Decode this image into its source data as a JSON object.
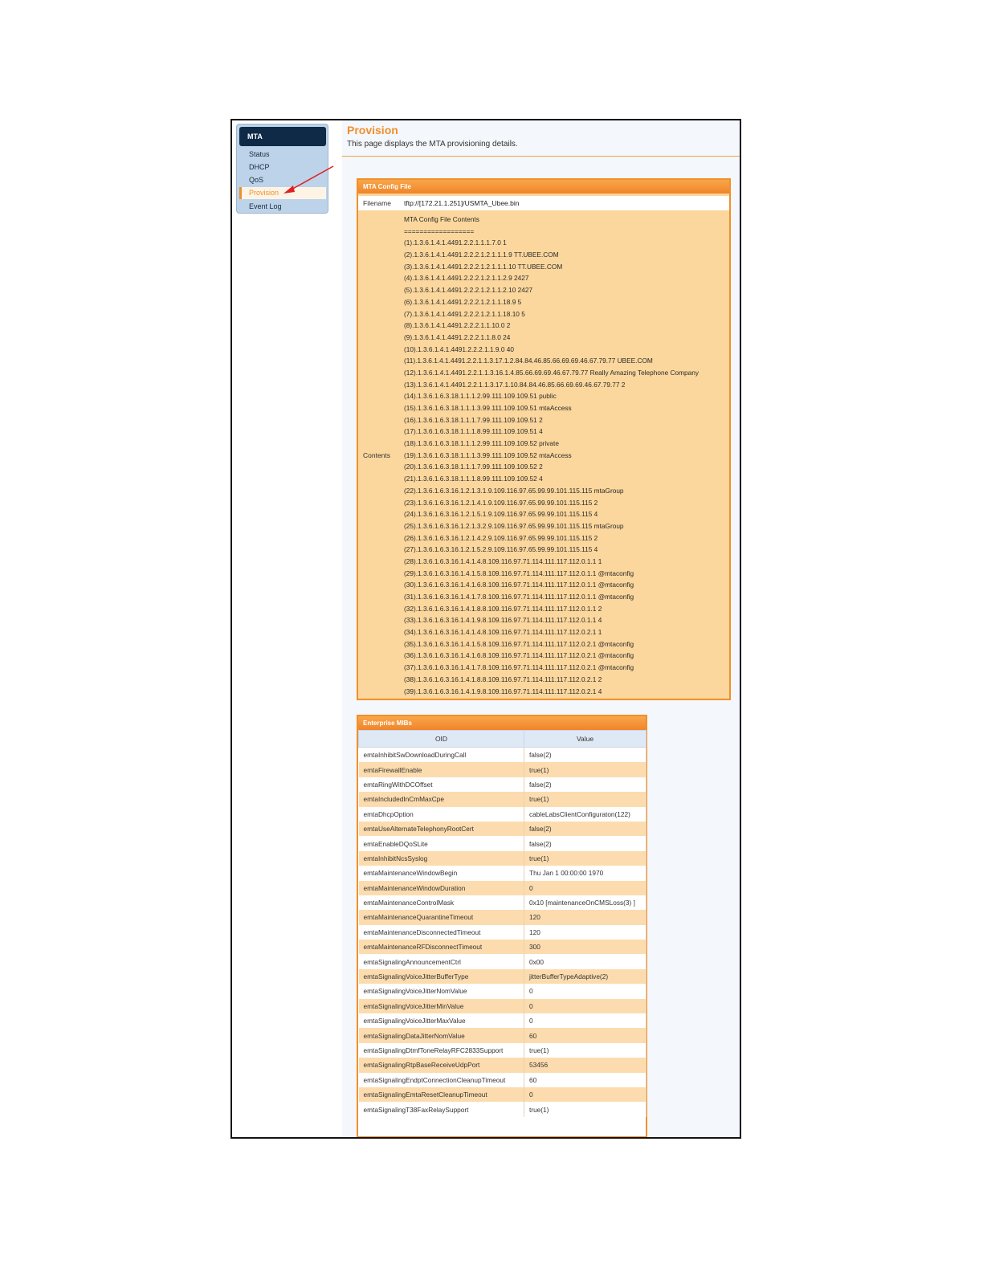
{
  "sidebar": {
    "header": "MTA",
    "items": [
      {
        "label": "Status",
        "active": false
      },
      {
        "label": "DHCP",
        "active": false
      },
      {
        "label": "QoS",
        "active": false
      },
      {
        "label": "Provision",
        "active": true
      },
      {
        "label": "Event Log",
        "active": false
      }
    ]
  },
  "page": {
    "title": "Provision",
    "description": "This page displays the MTA provisioning details."
  },
  "config_file": {
    "header": "MTA Config File",
    "filename_label": "Filename",
    "filename": "tftp://[172.21.1.251]/USMTA_Ubee.bin",
    "contents_label": "Contents",
    "lines": [
      "MTA Config File Contents",
      "==================",
      "(1).1.3.6.1.4.1.4491.2.2.1.1.1.7.0 1",
      "(2).1.3.6.1.4.1.4491.2.2.2.1.2.1.1.1.9 TT.UBEE.COM",
      "(3).1.3.6.1.4.1.4491.2.2.2.1.2.1.1.1.10 TT.UBEE.COM",
      "(4).1.3.6.1.4.1.4491.2.2.2.1.2.1.1.2.9 2427",
      "(5).1.3.6.1.4.1.4491.2.2.2.1.2.1.1.2.10 2427",
      "(6).1.3.6.1.4.1.4491.2.2.2.1.2.1.1.18.9 5",
      "(7).1.3.6.1.4.1.4491.2.2.2.1.2.1.1.18.10 5",
      "(8).1.3.6.1.4.1.4491.2.2.2.1.1.10.0 2",
      "(9).1.3.6.1.4.1.4491.2.2.2.1.1.8.0 24",
      "(10).1.3.6.1.4.1.4491.2.2.2.1.1.9.0 40",
      "(11).1.3.6.1.4.1.4491.2.2.1.1.3.17.1.2.84.84.46.85.66.69.69.46.67.79.77 UBEE.COM",
      "(12).1.3.6.1.4.1.4491.2.2.1.1.3.16.1.4.85.66.69.69.46.67.79.77 Really Amazing Telephone Company",
      "(13).1.3.6.1.4.1.4491.2.2.1.1.3.17.1.10.84.84.46.85.66.69.69.46.67.79.77 2",
      "(14).1.3.6.1.6.3.18.1.1.1.2.99.111.109.109.51 public",
      "(15).1.3.6.1.6.3.18.1.1.1.3.99.111.109.109.51 mtaAccess",
      "(16).1.3.6.1.6.3.18.1.1.1.7.99.111.109.109.51 2",
      "(17).1.3.6.1.6.3.18.1.1.1.8.99.111.109.109.51 4",
      "(18).1.3.6.1.6.3.18.1.1.1.2.99.111.109.109.52 private",
      "(19).1.3.6.1.6.3.18.1.1.1.3.99.111.109.109.52 mtaAccess",
      "(20).1.3.6.1.6.3.18.1.1.1.7.99.111.109.109.52 2",
      "(21).1.3.6.1.6.3.18.1.1.1.8.99.111.109.109.52 4",
      "(22).1.3.6.1.6.3.16.1.2.1.3.1.9.109.116.97.65.99.99.101.115.115 mtaGroup",
      "(23).1.3.6.1.6.3.16.1.2.1.4.1.9.109.116.97.65.99.99.101.115.115 2",
      "(24).1.3.6.1.6.3.16.1.2.1.5.1.9.109.116.97.65.99.99.101.115.115 4",
      "(25).1.3.6.1.6.3.16.1.2.1.3.2.9.109.116.97.65.99.99.101.115.115 mtaGroup",
      "(26).1.3.6.1.6.3.16.1.2.1.4.2.9.109.116.97.65.99.99.101.115.115 2",
      "(27).1.3.6.1.6.3.16.1.2.1.5.2.9.109.116.97.65.99.99.101.115.115 4",
      "(28).1.3.6.1.6.3.16.1.4.1.4.8.109.116.97.71.114.111.117.112.0.1.1 1",
      "(29).1.3.6.1.6.3.16.1.4.1.5.8.109.116.97.71.114.111.117.112.0.1.1 @mtaconfig",
      "(30).1.3.6.1.6.3.16.1.4.1.6.8.109.116.97.71.114.111.117.112.0.1.1 @mtaconfig",
      "(31).1.3.6.1.6.3.16.1.4.1.7.8.109.116.97.71.114.111.117.112.0.1.1 @mtaconfig",
      "(32).1.3.6.1.6.3.16.1.4.1.8.8.109.116.97.71.114.111.117.112.0.1.1 2",
      "(33).1.3.6.1.6.3.16.1.4.1.9.8.109.116.97.71.114.111.117.112.0.1.1 4",
      "(34).1.3.6.1.6.3.16.1.4.1.4.8.109.116.97.71.114.111.117.112.0.2.1 1",
      "(35).1.3.6.1.6.3.16.1.4.1.5.8.109.116.97.71.114.111.117.112.0.2.1 @mtaconfig",
      "(36).1.3.6.1.6.3.16.1.4.1.6.8.109.116.97.71.114.111.117.112.0.2.1 @mtaconfig",
      "(37).1.3.6.1.6.3.16.1.4.1.7.8.109.116.97.71.114.111.117.112.0.2.1 @mtaconfig",
      "(38).1.3.6.1.6.3.16.1.4.1.8.8.109.116.97.71.114.111.117.112.0.2.1 2",
      "(39).1.3.6.1.6.3.16.1.4.1.9.8.109.116.97.71.114.111.117.112.0.2.1 4"
    ]
  },
  "enterprise_mibs": {
    "header": "Enterprise MIBs",
    "columns": [
      "OID",
      "Value"
    ],
    "rows": [
      [
        "emtaInhibitSwDownloadDuringCall",
        "false(2)"
      ],
      [
        "emtaFirewallEnable",
        "true(1)"
      ],
      [
        "emtaRingWithDCOffset",
        "false(2)"
      ],
      [
        "emtaIncludedInCmMaxCpe",
        "true(1)"
      ],
      [
        "emtaDhcpOption",
        "cableLabsClientConfiguraton(122)"
      ],
      [
        "emtaUseAlternateTelephonyRootCert",
        "false(2)"
      ],
      [
        "emtaEnableDQoSLite",
        "false(2)"
      ],
      [
        "emtaInhibitNcsSyslog",
        "true(1)"
      ],
      [
        "emtaMaintenanceWindowBegin",
        "Thu Jan 1 00:00:00 1970"
      ],
      [
        "emtaMaintenanceWindowDuration",
        "0"
      ],
      [
        "emtaMaintenanceControlMask",
        "0x10 [maintenanceOnCMSLoss(3) ]"
      ],
      [
        "emtaMaintenanceQuarantineTimeout",
        "120"
      ],
      [
        "emtaMaintenanceDisconnectedTimeout",
        "120"
      ],
      [
        "emtaMaintenanceRFDisconnectTimeout",
        "300"
      ],
      [
        "emtaSignalingAnnouncementCtrl",
        "0x00"
      ],
      [
        "emtaSignalingVoiceJitterBufferType",
        "jitterBufferTypeAdaptive(2)"
      ],
      [
        "emtaSignalingVoiceJitterNomValue",
        "0"
      ],
      [
        "emtaSignalingVoiceJitterMinValue",
        "0"
      ],
      [
        "emtaSignalingVoiceJitterMaxValue",
        "0"
      ],
      [
        "emtaSignalingDataJitterNomValue",
        "60"
      ],
      [
        "emtaSignalingDtmfToneRelayRFC2833Support",
        "true(1)"
      ],
      [
        "emtaSignalingRtpBaseReceiveUdpPort",
        "53456"
      ],
      [
        "emtaSignalingEndptConnectionCleanupTimeout",
        "60"
      ],
      [
        "emtaSignalingEmtaResetCleanupTimeout",
        "0"
      ],
      [
        "emtaSignalingT38FaxRelaySupport",
        "true(1)"
      ]
    ]
  }
}
